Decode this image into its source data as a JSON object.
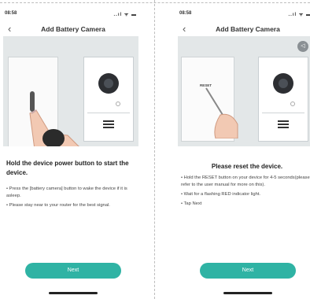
{
  "screens": [
    {
      "status": {
        "time": "08:58",
        "icons": "..ıl ᯤ ▬"
      },
      "title": "Add Battery Camera",
      "heading": "Hold the device power button to start the device.",
      "bullets": [
        "• Press the [battery camera] button to wake the device if it is asleep.",
        "• Please stay near to your router for the best signal."
      ],
      "next_label": "Next"
    },
    {
      "status": {
        "time": "08:58",
        "icons": "..ıl ᯤ ▬"
      },
      "title": "Add Battery Camera",
      "heading": "Please reset the device.",
      "illustration_label": "RESET",
      "bullets": [
        "• Hold the RESET button on your device for 4-5 seconds(please refer to the user manual for more on this).",
        "• Wait for a flashing RED indicator light.",
        "• Tap Next"
      ],
      "next_label": "Next"
    }
  ],
  "colors": {
    "accent": "#2fb3a4",
    "arrow": "#ef6a3a",
    "illustration_bg": "#e3e7e8"
  },
  "icons": {
    "back": "chevron-left-icon",
    "mute": "speaker-mute-icon"
  }
}
